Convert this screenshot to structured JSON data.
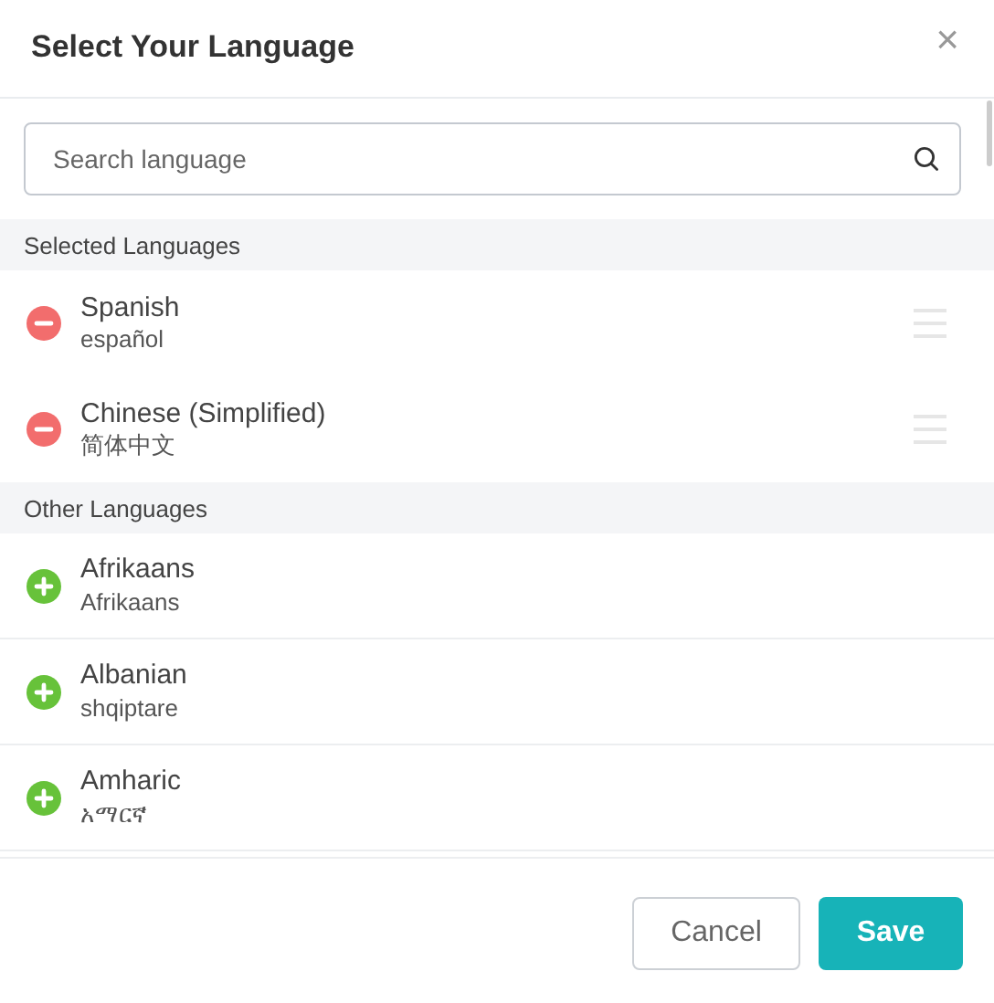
{
  "dialog": {
    "title": "Select Your Language",
    "close": "×"
  },
  "search": {
    "placeholder": "Search language"
  },
  "sections": [
    {
      "heading": "Selected Languages",
      "kind": "selected",
      "items": [
        {
          "name": "Spanish",
          "native": "español"
        },
        {
          "name": "Chinese (Simplified)",
          "native": "简体中文"
        }
      ]
    },
    {
      "heading": "Other Languages",
      "kind": "other",
      "items": [
        {
          "name": "Afrikaans",
          "native": "Afrikaans"
        },
        {
          "name": "Albanian",
          "native": "shqiptare"
        },
        {
          "name": "Amharic",
          "native": "አማርኛ"
        }
      ]
    }
  ],
  "buttons": [
    {
      "label": "Cancel",
      "kind": "secondary"
    },
    {
      "label": "Save",
      "kind": "primary"
    }
  ]
}
